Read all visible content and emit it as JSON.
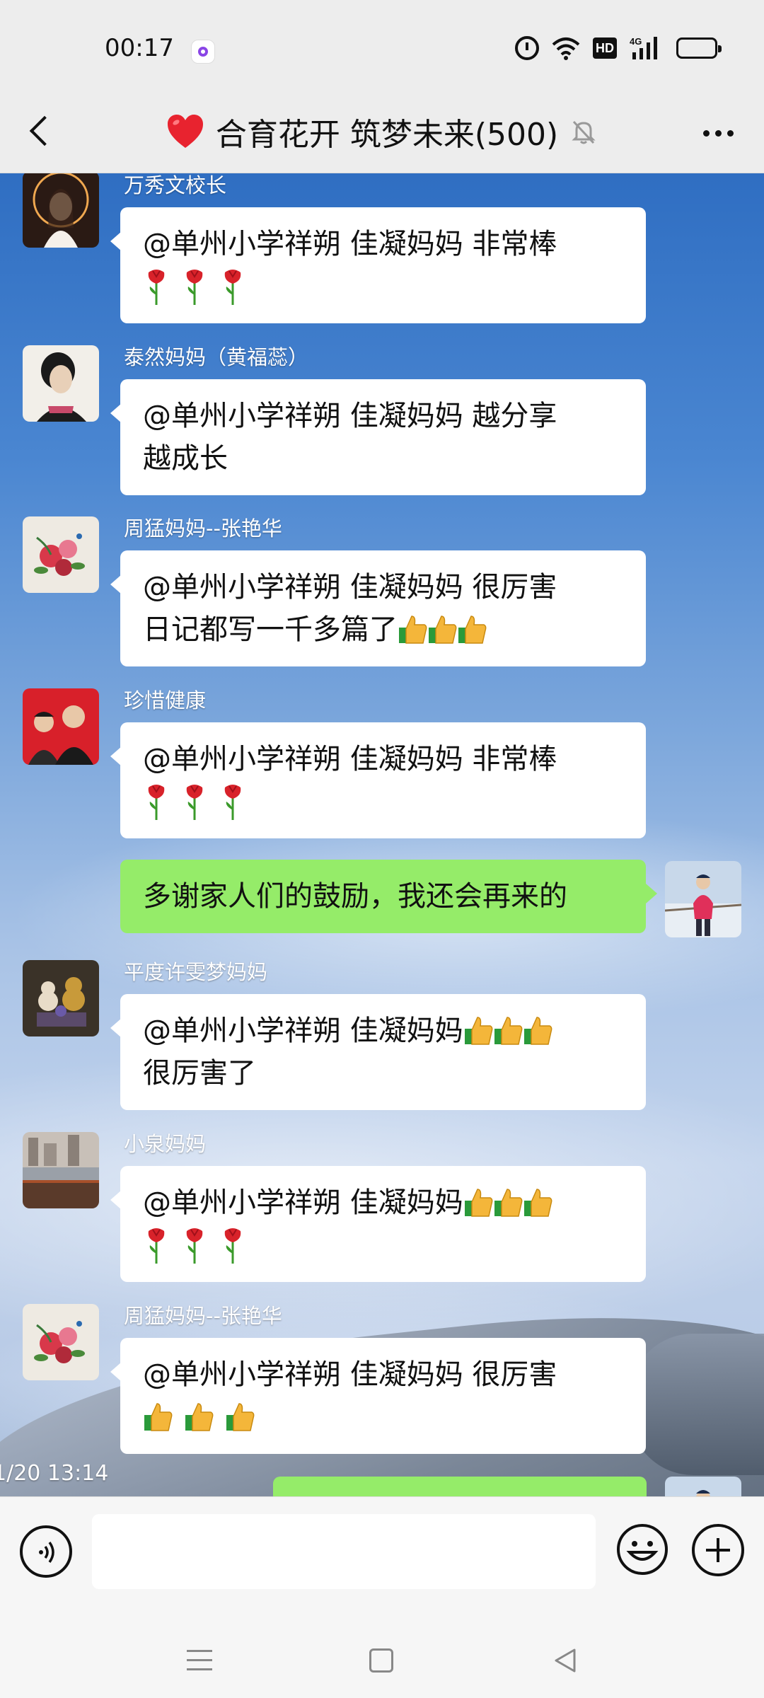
{
  "status": {
    "time": "00:17",
    "icons": [
      "app-indicator-icon",
      "alarm-icon",
      "wifi-icon",
      "hd-icon",
      "signal-4g-icon",
      "battery-icon"
    ],
    "hd": "HD",
    "network": "4G"
  },
  "header": {
    "title": "合育花开 筑梦未来(500)",
    "icons": [
      "back-arrow-icon",
      "heart-icon",
      "mute-bell-icon",
      "more-icon"
    ]
  },
  "messages": [
    {
      "sender": "万秀文校长",
      "lines": [
        "@单州小学祥朔 佳凝妈妈  非常棒"
      ],
      "emoji": [
        "rose",
        "rose",
        "rose"
      ]
    },
    {
      "sender": "泰然妈妈（黄福蕊）",
      "lines": [
        "@单州小学祥朔 佳凝妈妈  越分享",
        "越成长"
      ],
      "emoji": []
    },
    {
      "sender": "周猛妈妈--张艳华",
      "lines": [
        "@单州小学祥朔 佳凝妈妈  很厉害",
        "日记都写一千多篇了"
      ],
      "emoji_inline": [
        "thumbs-up",
        "thumbs-up",
        "thumbs-up"
      ]
    },
    {
      "sender": "珍惜健康",
      "lines": [
        "@单州小学祥朔 佳凝妈妈  非常棒"
      ],
      "emoji": [
        "rose",
        "rose",
        "rose"
      ]
    },
    {
      "sender": "",
      "self": true,
      "lines": [
        "多谢家人们的鼓励，我还会再来的"
      ]
    },
    {
      "sender": "平度许雯梦妈妈",
      "lines": [
        "@单州小学祥朔 佳凝妈妈 ",
        "很厉害了"
      ],
      "emoji_inline_first": [
        "thumbs-up",
        "thumbs-up",
        "thumbs-up"
      ]
    },
    {
      "sender": "小泉妈妈",
      "lines": [
        "@单州小学祥朔 佳凝妈妈 "
      ],
      "emoji_inline_first": [
        "thumbs-up",
        "thumbs-up",
        "thumbs-up"
      ],
      "emoji": [
        "rose",
        "rose",
        "rose"
      ]
    },
    {
      "sender": "周猛妈妈--张艳华",
      "lines": [
        "@单州小学祥朔 佳凝妈妈  很厉害"
      ],
      "emoji_thumbs": [
        "thumbs-up",
        "thumbs-up",
        "thumbs-up"
      ]
    }
  ],
  "timestamp": "1/20 13:14",
  "input": {
    "placeholder": "",
    "icons": [
      "voice-icon",
      "emoji-face-icon",
      "plus-icon"
    ]
  },
  "nav": {
    "icons": [
      "menu-lines-icon",
      "home-square-icon",
      "back-triangle-icon"
    ]
  },
  "colors": {
    "self_bubble": "#95ec69",
    "other_bubble": "#ffffff",
    "header_bg": "#ededed"
  }
}
